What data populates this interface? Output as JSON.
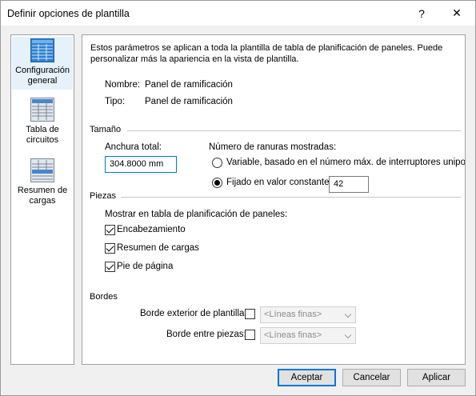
{
  "window": {
    "title": "Definir opciones de plantilla",
    "help_label": "?",
    "close_label": "✕"
  },
  "nav": {
    "items": [
      {
        "label": "Configuración general",
        "icon": "table-grid-icon",
        "active": true
      },
      {
        "label": "Tabla de circuitos",
        "icon": "circuit-table-icon",
        "active": false
      },
      {
        "label": "Resumen de cargas",
        "icon": "load-summary-icon",
        "active": false
      }
    ]
  },
  "general": {
    "description": "Estos parámetros se aplican a toda la plantilla de tabla de planificación de paneles. Puede personalizar más la apariencia en la vista de plantilla.",
    "name_label": "Nombre:",
    "name_value": "Panel de ramificación",
    "type_label": "Tipo:",
    "type_value": "Panel de ramificación"
  },
  "size": {
    "section_title": "Tamaño",
    "total_width_label": "Anchura total:",
    "total_width_value": "304.8000 mm",
    "slots_label": "Número de ranuras mostradas:",
    "variable_option": "Variable, basado en el número máx. de interruptores unipolares",
    "variable_selected": false,
    "fixed_option": "Fijado en valor constante:",
    "fixed_selected": true,
    "fixed_value": "42"
  },
  "parts": {
    "section_title": "Piezas",
    "show_label": "Mostrar en tabla de planificación de paneles:",
    "header": {
      "label": "Encabezamiento",
      "checked": true
    },
    "load_summary": {
      "label": "Resumen de cargas",
      "checked": true
    },
    "footer": {
      "label": "Pie de página",
      "checked": true
    }
  },
  "borders": {
    "section_title": "Bordes",
    "outer_label": "Borde exterior de plantilla:",
    "outer_checked": false,
    "outer_value": "<Líneas finas>",
    "between_label": "Borde entre piezas:",
    "between_checked": false,
    "between_value": "<Líneas finas>"
  },
  "buttons": {
    "accept": "Aceptar",
    "cancel": "Cancelar",
    "apply": "Aplicar"
  }
}
